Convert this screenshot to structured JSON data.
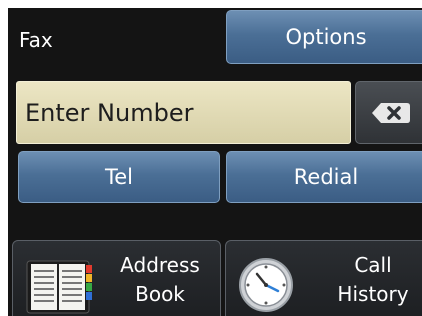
{
  "header": {
    "mode": "Fax",
    "options_label": "Options"
  },
  "number_entry": {
    "value": "Enter Number",
    "backspace_icon": "backspace-icon"
  },
  "dial_buttons": {
    "tel_label": "Tel",
    "redial_label": "Redial"
  },
  "shortcuts": [
    {
      "line1": "Address",
      "line2": "Book",
      "icon": "address-book-icon"
    },
    {
      "line1": "Call",
      "line2": "History",
      "icon": "clock-icon"
    }
  ]
}
